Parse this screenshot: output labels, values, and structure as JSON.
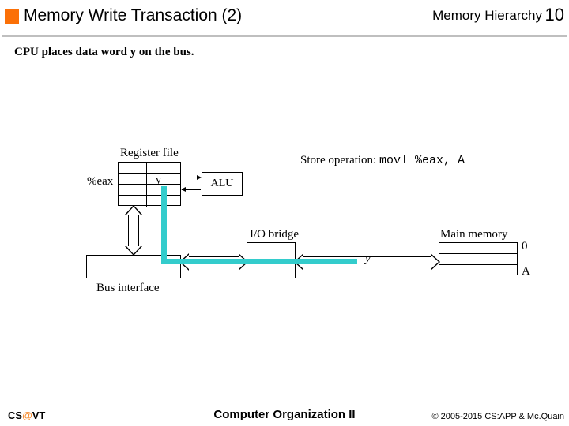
{
  "header": {
    "title": "Memory Write Transaction (2)",
    "section": "Memory Hierarchy",
    "pagenum": "10"
  },
  "subtitle": "CPU places data word y on the bus.",
  "labels": {
    "register_file": "Register file",
    "eax": "%eax",
    "y_cell": "y",
    "alu": "ALU",
    "store_prefix": "Store operation:",
    "store_code": "movl %eax, A",
    "io_bridge": "I/O bridge",
    "bus_interface": "Bus interface",
    "main_memory": "Main memory",
    "mem_zero": "0",
    "mem_A": "A",
    "y_on_bus": "y"
  },
  "footer": {
    "left_a": "CS",
    "left_at": "@",
    "left_b": "VT",
    "center": "Computer Organization II",
    "right": "© 2005-2015 CS:APP & Mc.Quain"
  },
  "colors": {
    "accent": "#fb7007",
    "teal": "#33cccc"
  }
}
